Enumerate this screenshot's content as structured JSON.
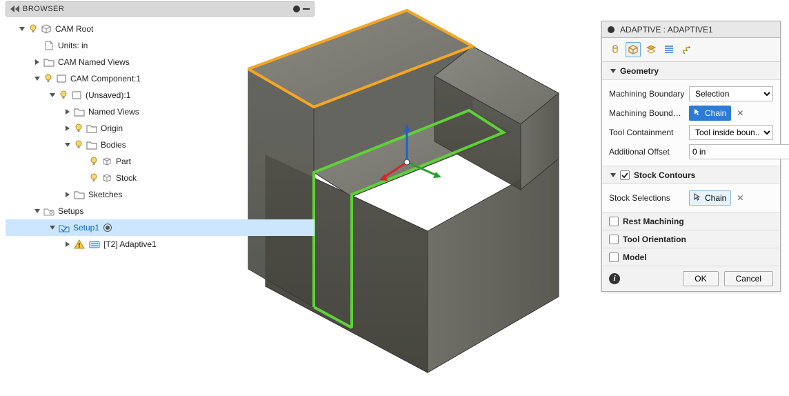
{
  "browser": {
    "title": "BROWSER",
    "tree": [
      {
        "indent": 0,
        "tri": "down",
        "bulb": true,
        "icon": "component-root",
        "label": "CAM Root"
      },
      {
        "indent": 1,
        "tri": "none",
        "bulb": false,
        "icon": "doc",
        "label": "Units: in"
      },
      {
        "indent": 1,
        "tri": "right",
        "bulb": false,
        "icon": "folder",
        "label": "CAM Named Views"
      },
      {
        "indent": 1,
        "tri": "down",
        "bulb": true,
        "icon": "component",
        "label": "CAM Component:1"
      },
      {
        "indent": 2,
        "tri": "down",
        "bulb": true,
        "icon": "component",
        "label": "(Unsaved):1"
      },
      {
        "indent": 3,
        "tri": "right",
        "bulb": false,
        "icon": "folder",
        "label": "Named Views"
      },
      {
        "indent": 3,
        "tri": "right",
        "bulb": true,
        "icon": "folder",
        "label": "Origin"
      },
      {
        "indent": 3,
        "tri": "down",
        "bulb": true,
        "icon": "folder",
        "label": "Bodies"
      },
      {
        "indent": 4,
        "tri": "none",
        "bulb": true,
        "icon": "body",
        "label": "Part"
      },
      {
        "indent": 4,
        "tri": "none",
        "bulb": true,
        "icon": "body",
        "label": "Stock"
      },
      {
        "indent": 3,
        "tri": "right",
        "bulb": false,
        "icon": "folder",
        "label": "Sketches"
      },
      {
        "indent": 1,
        "tri": "down",
        "bulb": false,
        "icon": "setups",
        "label": "Setups"
      },
      {
        "indent": 2,
        "tri": "down",
        "bulb": false,
        "icon": "setup",
        "label": "Setup1",
        "selected": true,
        "blue": true,
        "radio": true
      },
      {
        "indent": 3,
        "tri": "right",
        "bulb": false,
        "icon": "warn",
        "icon2": "op",
        "label": "[T2] Adaptive1"
      }
    ]
  },
  "panel": {
    "title": "ADAPTIVE : ADAPTIVE1",
    "tabs": [
      "tool",
      "geometry",
      "heights",
      "passes",
      "linking"
    ],
    "active_tab": 1,
    "geometry": {
      "title": "Geometry",
      "machining_boundary_label": "Machining Boundary",
      "machining_boundary_value": "Selection",
      "machining_boundary_sel_label": "Machining Boundary...",
      "machining_boundary_chip": "Chain",
      "tool_containment_label": "Tool Containment",
      "tool_containment_value": "Tool inside boun...",
      "additional_offset_label": "Additional Offset",
      "additional_offset_value": "0 in"
    },
    "stock_contours": {
      "title": "Stock Contours",
      "checked": true,
      "stock_selections_label": "Stock Selections",
      "stock_selections_chip": "Chain"
    },
    "rest_machining": {
      "title": "Rest Machining",
      "checked": false
    },
    "tool_orientation": {
      "title": "Tool Orientation",
      "checked": false
    },
    "model": {
      "title": "Model",
      "checked": false
    },
    "ok": "OK",
    "cancel": "Cancel"
  },
  "chart_data": null
}
